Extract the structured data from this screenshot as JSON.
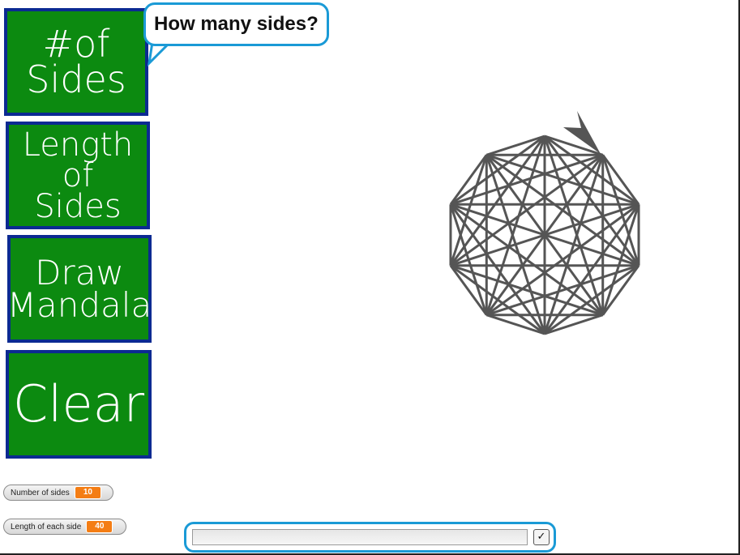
{
  "buttons": {
    "number_of_sides": "#of\nSides",
    "length_of_sides": "Length\nof\nSides",
    "draw_mandala": "Draw\nMandala",
    "clear": "Clear"
  },
  "bubble": {
    "text": "How many sides?"
  },
  "watchers": {
    "sides": {
      "label": "Number of sides",
      "value": "10"
    },
    "length": {
      "label": "Length of each side",
      "value": "40"
    }
  },
  "ask": {
    "value": "",
    "submit_symbol": "✓"
  },
  "colors": {
    "button_fill": "#0c8a10",
    "button_border": "#0b2a92",
    "accent": "#1a9ad6",
    "watcher_value": "#f47d14",
    "pen": "#555555"
  },
  "mandala": {
    "sides": 10
  }
}
